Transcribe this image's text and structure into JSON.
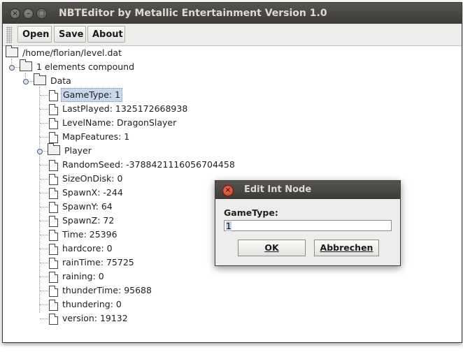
{
  "window": {
    "title": "NBTEditor by Metallic Entertainment Version 1.0",
    "close_glyph": "×",
    "min_glyph": "–",
    "max_glyph": "□"
  },
  "toolbar": {
    "open_label": "Open",
    "save_label": "Save",
    "about_label": "About"
  },
  "tree": {
    "root": "/home/florian/level.dat",
    "compound": "1 elements compound",
    "data": "Data",
    "items": [
      "GameType: 1",
      "LastPlayed: 1325172668938",
      "LevelName: DragonSlayer",
      "MapFeatures: 1",
      "Player",
      "RandomSeed: -3788421116056704458",
      "SizeOnDisk: 0",
      "SpawnX: -244",
      "SpawnY: 64",
      "SpawnZ: 72",
      "Time: 25396",
      "hardcore: 0",
      "rainTime: 75725",
      "raining: 0",
      "thunderTime: 95688",
      "thundering: 0",
      "version: 19132"
    ]
  },
  "dialog": {
    "title": "Edit Int Node",
    "close_glyph": "×",
    "field_label": "GameType:",
    "field_value": "1",
    "ok_label": "OK",
    "cancel_label": "Abbrechen"
  }
}
